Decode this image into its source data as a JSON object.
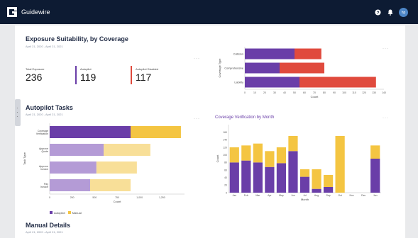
{
  "app": {
    "brand": "Guidewire",
    "avatar_initials": "hp"
  },
  "colors": {
    "purple": "#6a3ea8",
    "orange": "#e4533a",
    "red": "#e04a3d",
    "yellow": "#f4c542",
    "purple_light": "#b49bd6",
    "yellow_light": "#f8df98",
    "nav": "#0d1b33"
  },
  "exposure": {
    "title": "Exposure Suitability, by Coverage",
    "date_range": "April 21, 2020 - April 21, 2021",
    "stats": [
      {
        "label": "Total Exposure",
        "value": "236"
      },
      {
        "label": "Autopilot",
        "value": "119"
      },
      {
        "label": "Autopilot Disabled",
        "value": "117"
      }
    ]
  },
  "autopilot": {
    "title": "Autopilot Tasks",
    "date_range": "April 21, 2020 - April 21, 2021"
  },
  "coverage_month": {
    "title": "Coverage Verification by Month"
  },
  "manual": {
    "title": "Manual Details",
    "date_range": "April 21, 2020 - April 21, 2021"
  },
  "chart_data": [
    {
      "type": "bar",
      "orientation": "horizontal",
      "stacked": true,
      "categories": [
        "Collision",
        "Comprehensive",
        "Liability"
      ],
      "series": [
        {
          "values": [
            50,
            35,
            55
          ],
          "color": "#6a3ea8"
        },
        {
          "values": [
            27,
            45,
            77
          ],
          "color": "#e04a3d"
        }
      ],
      "xlabel": "Count",
      "ylabel": "Coverage Type",
      "xlim": [
        0,
        140
      ],
      "xticks": [
        "0",
        "10",
        "20",
        "30",
        "40",
        "50",
        "60",
        "70",
        "80",
        "90",
        "100",
        "110",
        "120",
        "130",
        "140"
      ]
    },
    {
      "type": "bar",
      "orientation": "horizontal",
      "stacked": true,
      "categories": [
        "Coverage Verification",
        "Approve Quote",
        "Approve Invoice",
        "Pay Invoice"
      ],
      "series": [
        {
          "name": "Autopilot",
          "values": [
            900,
            600,
            520,
            450
          ],
          "colors": [
            "#6a3ea8",
            "#b49bd6",
            "#b49bd6",
            "#b49bd6"
          ]
        },
        {
          "name": "Manual",
          "values": [
            560,
            520,
            450,
            450
          ],
          "colors": [
            "#f4c542",
            "#f8df98",
            "#f8df98",
            "#f8df98"
          ]
        }
      ],
      "xlabel": "Count",
      "ylabel": "Task Type",
      "xlim": [
        0,
        1500
      ],
      "xticks": [
        "0",
        "250",
        "500",
        "750",
        "1,000",
        "1,250"
      ],
      "legend": [
        "Autopilot",
        "Manual"
      ]
    },
    {
      "type": "bar",
      "stacked": true,
      "title": "Coverage Verification by Month",
      "categories": [
        "Jan",
        "Feb",
        "Mar",
        "Apr",
        "May",
        "Jun",
        "Jul",
        "Aug",
        "Sep",
        "Oct",
        "Nov",
        "Dec",
        "Jan"
      ],
      "series": [
        {
          "values": [
            80,
            85,
            80,
            68,
            78,
            110,
            42,
            10,
            15,
            0,
            0,
            0,
            90
          ],
          "color": "#6a3ea8"
        },
        {
          "values": [
            40,
            40,
            50,
            42,
            42,
            40,
            20,
            52,
            32,
            150,
            0,
            0,
            35
          ],
          "color": "#f4c542"
        }
      ],
      "xlabel": "Month",
      "ylabel": "Count",
      "ylim": [
        0,
        180
      ],
      "yticks": [
        "0",
        "20",
        "40",
        "60",
        "80",
        "100",
        "120",
        "140",
        "160"
      ]
    }
  ]
}
